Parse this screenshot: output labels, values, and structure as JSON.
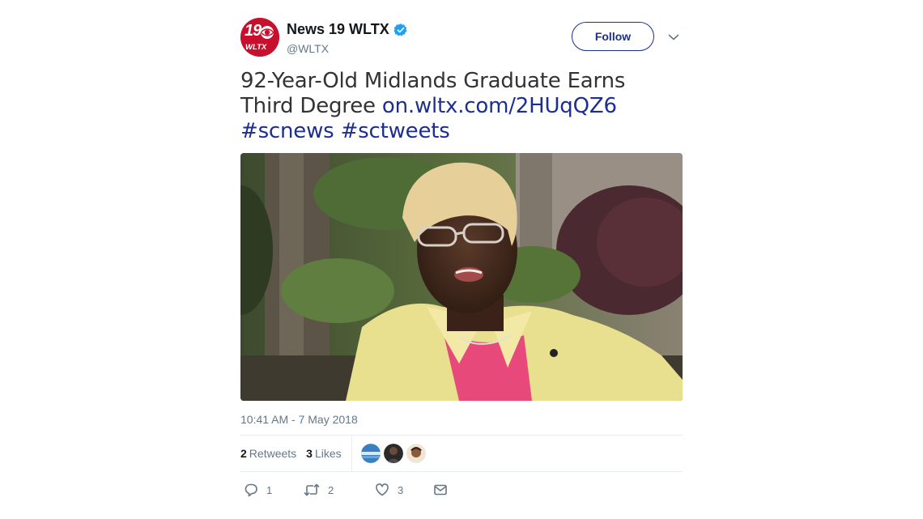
{
  "account": {
    "display_name": "News 19 WLTX",
    "handle": "@WLTX",
    "verified": true,
    "logo_number": "19",
    "logo_call": "WLTX"
  },
  "follow_label": "Follow",
  "tweet": {
    "text": "92-Year-Old Midlands Graduate Earns Third Degree",
    "link": "on.wltx.com/2HUqQZ6",
    "hashtag1": "#scnews",
    "hashtag2": "#sctweets"
  },
  "timestamp": "10:41 AM - 7 May 2018",
  "stats": {
    "retweets_count": "2",
    "retweets_label": "Retweets",
    "likes_count": "3",
    "likes_label": "Likes"
  },
  "actions": {
    "reply_count": "1",
    "retweet_count": "2",
    "like_count": "3"
  },
  "colors": {
    "link": "#1c2f8f",
    "verified": "#1da1f2",
    "brand_red": "#c8102e",
    "muted": "#657786"
  },
  "icons": [
    "verified-badge-icon",
    "chevron-down-icon",
    "reply-icon",
    "retweet-icon",
    "like-icon",
    "message-icon"
  ]
}
